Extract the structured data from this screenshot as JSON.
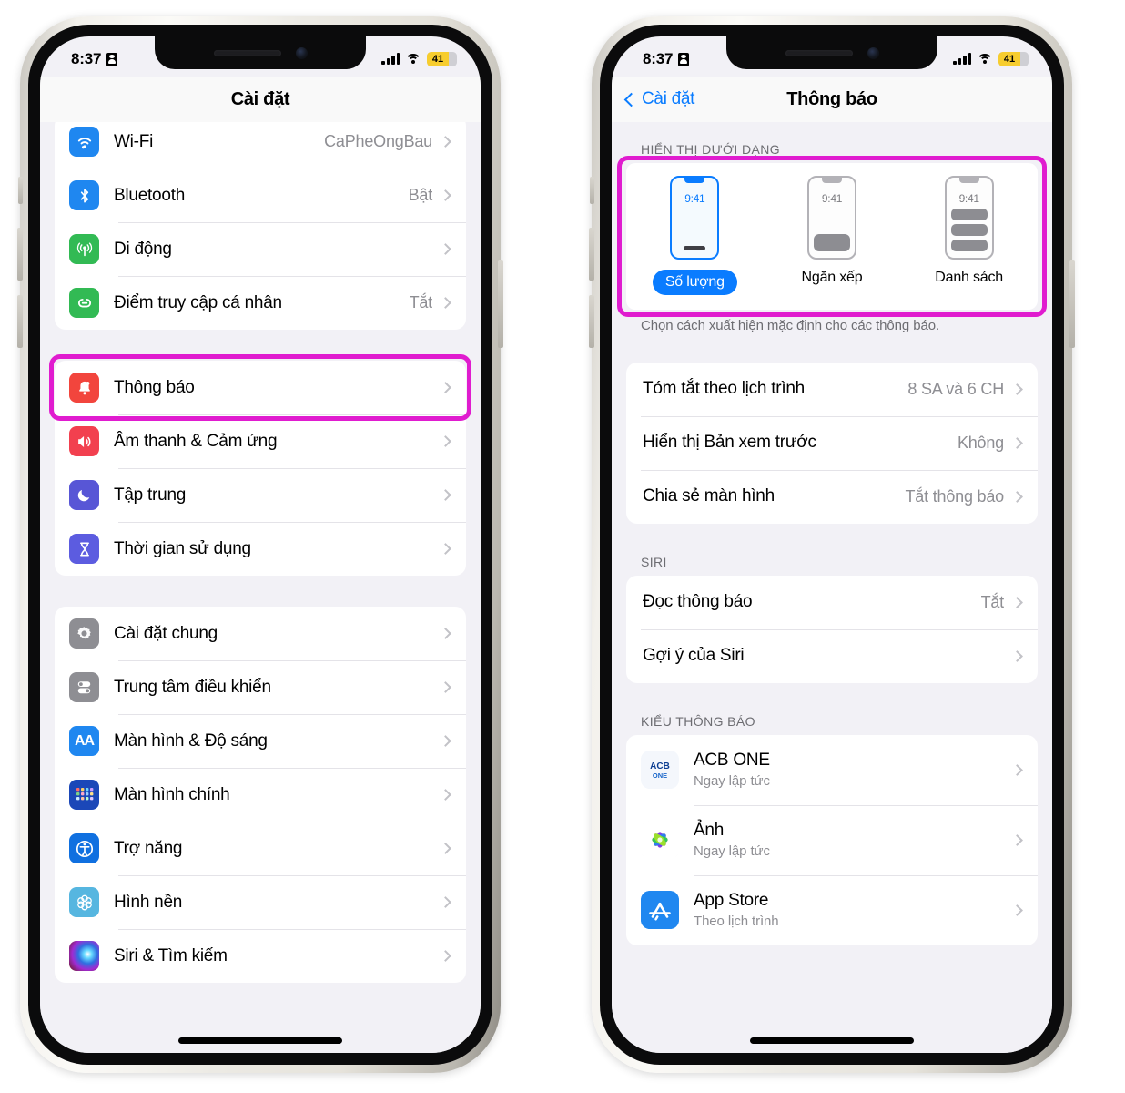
{
  "statusbar": {
    "time": "8:37",
    "battery_percent": "41",
    "lock_icon": "lock-portrait-icon",
    "signal_icon": "cellular-signal-icon",
    "wifi_icon": "wifi-icon"
  },
  "left_phone": {
    "nav": {
      "title": "Cài đặt"
    },
    "group1": [
      {
        "icon": "wifi-icon",
        "label": "Wi-Fi",
        "value": "CaPheOngBau"
      },
      {
        "icon": "bluetooth-icon",
        "label": "Bluetooth",
        "value": "Bật"
      },
      {
        "icon": "cellular-icon",
        "label": "Di động",
        "value": ""
      },
      {
        "icon": "hotspot-icon",
        "label": "Điểm truy cập cá nhân",
        "value": "Tắt"
      }
    ],
    "group2": [
      {
        "icon": "notifications-bell-icon",
        "label": "Thông báo",
        "value": "",
        "highlighted": true
      },
      {
        "icon": "sound-haptics-icon",
        "label": "Âm thanh & Cảm ứng",
        "value": ""
      },
      {
        "icon": "focus-moon-icon",
        "label": "Tập trung",
        "value": ""
      },
      {
        "icon": "screen-time-hourglass-icon",
        "label": "Thời gian sử dụng",
        "value": ""
      }
    ],
    "group3": [
      {
        "icon": "general-gear-icon",
        "label": "Cài đặt chung",
        "value": ""
      },
      {
        "icon": "control-center-icon",
        "label": "Trung tâm điều khiển",
        "value": ""
      },
      {
        "icon": "display-brightness-aa-icon",
        "label": "Màn hình & Độ sáng",
        "value": ""
      },
      {
        "icon": "home-screen-icon",
        "label": "Màn hình chính",
        "value": ""
      },
      {
        "icon": "accessibility-icon",
        "label": "Trợ năng",
        "value": ""
      },
      {
        "icon": "wallpaper-icon",
        "label": "Hình nền",
        "value": ""
      },
      {
        "icon": "siri-search-icon",
        "label": "Siri & Tìm kiếm",
        "value": ""
      }
    ]
  },
  "right_phone": {
    "nav": {
      "back_label": "Cài đặt",
      "title": "Thông báo"
    },
    "display_as": {
      "section_header": "HIỂN THỊ DƯỚI DẠNG",
      "footer": "Chọn cách xuất hiện mặc định cho các thông báo.",
      "options": [
        {
          "label": "Số lượng",
          "mini_time": "9:41",
          "selected": true,
          "style": "count"
        },
        {
          "label": "Ngăn xếp",
          "mini_time": "9:41",
          "selected": false,
          "style": "stack"
        },
        {
          "label": "Danh sách",
          "mini_time": "9:41",
          "selected": false,
          "style": "list"
        }
      ]
    },
    "options_group": [
      {
        "label": "Tóm tắt theo lịch trình",
        "value": "8 SA và 6 CH"
      },
      {
        "label": "Hiển thị Bản xem trước",
        "value": "Không"
      },
      {
        "label": "Chia sẻ màn hình",
        "value": "Tắt thông báo"
      }
    ],
    "siri_section": {
      "header": "SIRI",
      "rows": [
        {
          "label": "Đọc thông báo",
          "value": "Tắt"
        },
        {
          "label": "Gợi ý của Siri",
          "value": ""
        }
      ]
    },
    "style_section": {
      "header": "KIỂU THÔNG BÁO",
      "apps": [
        {
          "icon": "acb-one-app-icon",
          "name": "ACB ONE",
          "sub": "Ngay lập tức"
        },
        {
          "icon": "photos-app-icon",
          "name": "Ảnh",
          "sub": "Ngay lập tức"
        },
        {
          "icon": "app-store-app-icon",
          "name": "App Store",
          "sub": "Theo lịch trình"
        }
      ]
    }
  },
  "colors": {
    "highlight": "#e01ccf",
    "accent_blue": "#0a7cff",
    "battery_yellow": "#f7cd2e"
  }
}
